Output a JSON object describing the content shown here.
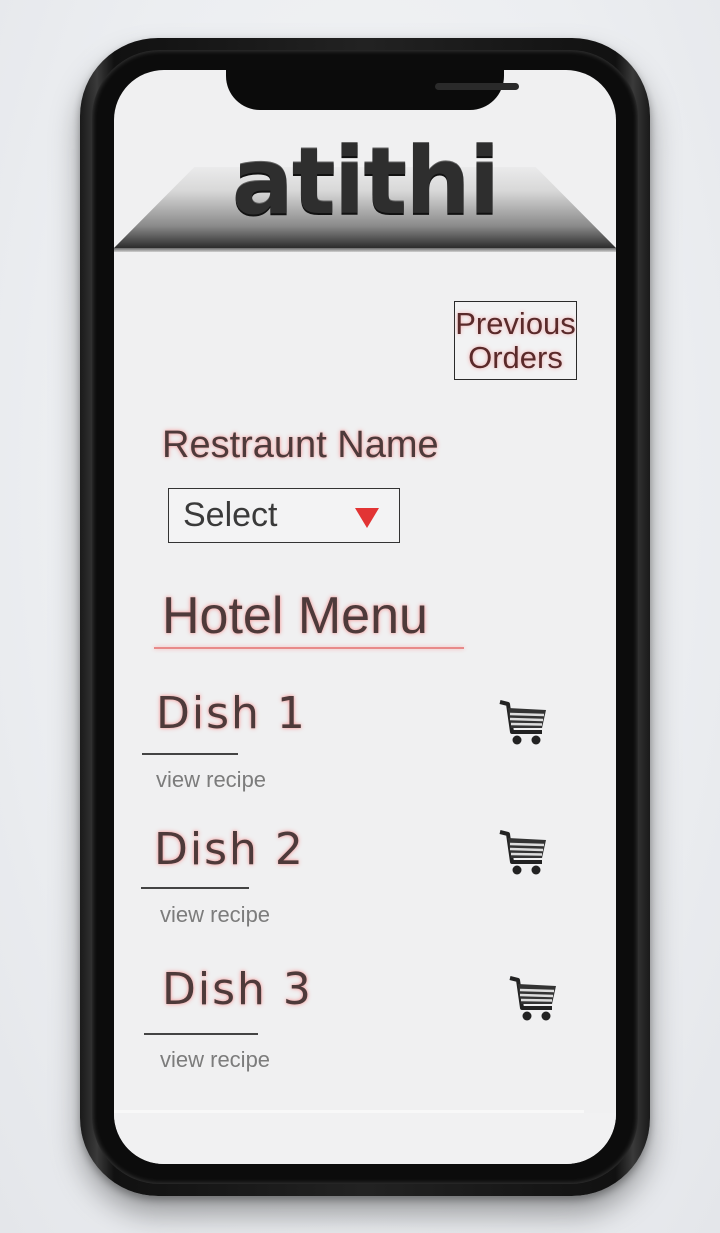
{
  "app": {
    "logo": "atithi"
  },
  "header": {
    "previous_orders_label": "Previous\nOrders"
  },
  "restaurant": {
    "label": "Restraunt Name",
    "select_value": "Select"
  },
  "menu": {
    "title": "Hotel Menu",
    "dishes": [
      {
        "name": "Dish 1",
        "recipe_label": "view recipe",
        "cart_icon": "shopping-cart-icon"
      },
      {
        "name": "Dish 2",
        "recipe_label": "view recipe",
        "cart_icon": "shopping-cart-icon"
      },
      {
        "name": "Dish 3",
        "recipe_label": "view recipe",
        "cart_icon": "shopping-cart-icon"
      }
    ]
  },
  "colors": {
    "label_glow": "#f3a1a1",
    "dropdown_arrow": "#e23434",
    "phone_frame": "#1a1a1a"
  }
}
